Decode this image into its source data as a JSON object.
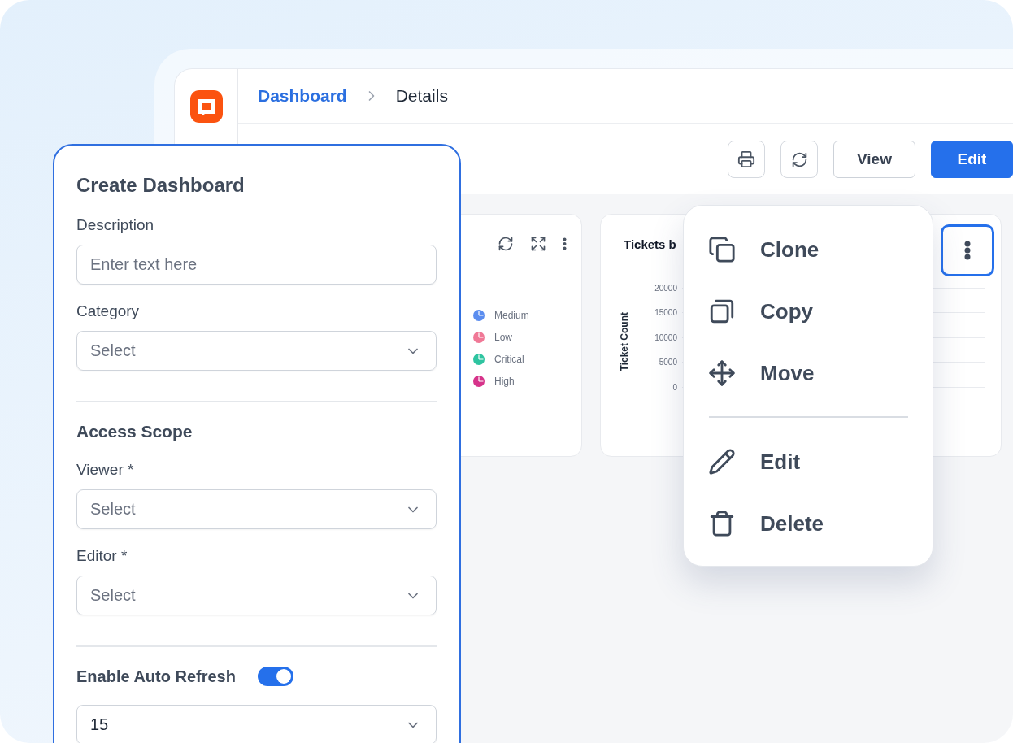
{
  "breadcrumb": [
    {
      "label": "Dashboard",
      "current": false
    },
    {
      "label": "Details",
      "current": true
    }
  ],
  "toolbar": {
    "buttons": [
      {
        "label": "View",
        "primary": false
      },
      {
        "label": "Edit",
        "primary": true
      }
    ]
  },
  "cards": [
    {
      "legend": [
        {
          "label": "Medium",
          "color": "#5b8def"
        },
        {
          "label": "Low",
          "color": "#f07896"
        },
        {
          "label": "Critical",
          "color": "#2ec4a0"
        },
        {
          "label": "High",
          "color": "#d6338a"
        }
      ]
    },
    {
      "title": "Tickets b",
      "y_label": "Ticket Count",
      "y_ticks": [
        "20000",
        "15000",
        "10000",
        "5000",
        "0"
      ],
      "menu_focused": true
    }
  ],
  "context_menu": {
    "groups": [
      [
        {
          "label": "Clone"
        },
        {
          "label": "Copy"
        },
        {
          "label": "Move"
        }
      ],
      [
        {
          "label": "Edit"
        },
        {
          "label": "Delete"
        }
      ]
    ]
  },
  "form": {
    "title": "Create Dashboard",
    "sections": [
      {
        "fields": [
          {
            "kind": "text",
            "label": "Description",
            "placeholder": "Enter text here"
          },
          {
            "kind": "select",
            "label": "Category",
            "placeholder": "Select"
          }
        ]
      },
      {
        "heading": "Access Scope",
        "fields": [
          {
            "kind": "select",
            "label": "Viewer *",
            "placeholder": "Select"
          },
          {
            "kind": "select",
            "label": "Editor *",
            "placeholder": "Select"
          }
        ]
      },
      {
        "fields": [
          {
            "kind": "toggle",
            "label": "Enable Auto Refresh",
            "on": true
          },
          {
            "kind": "select",
            "value": "15"
          }
        ]
      }
    ]
  }
}
